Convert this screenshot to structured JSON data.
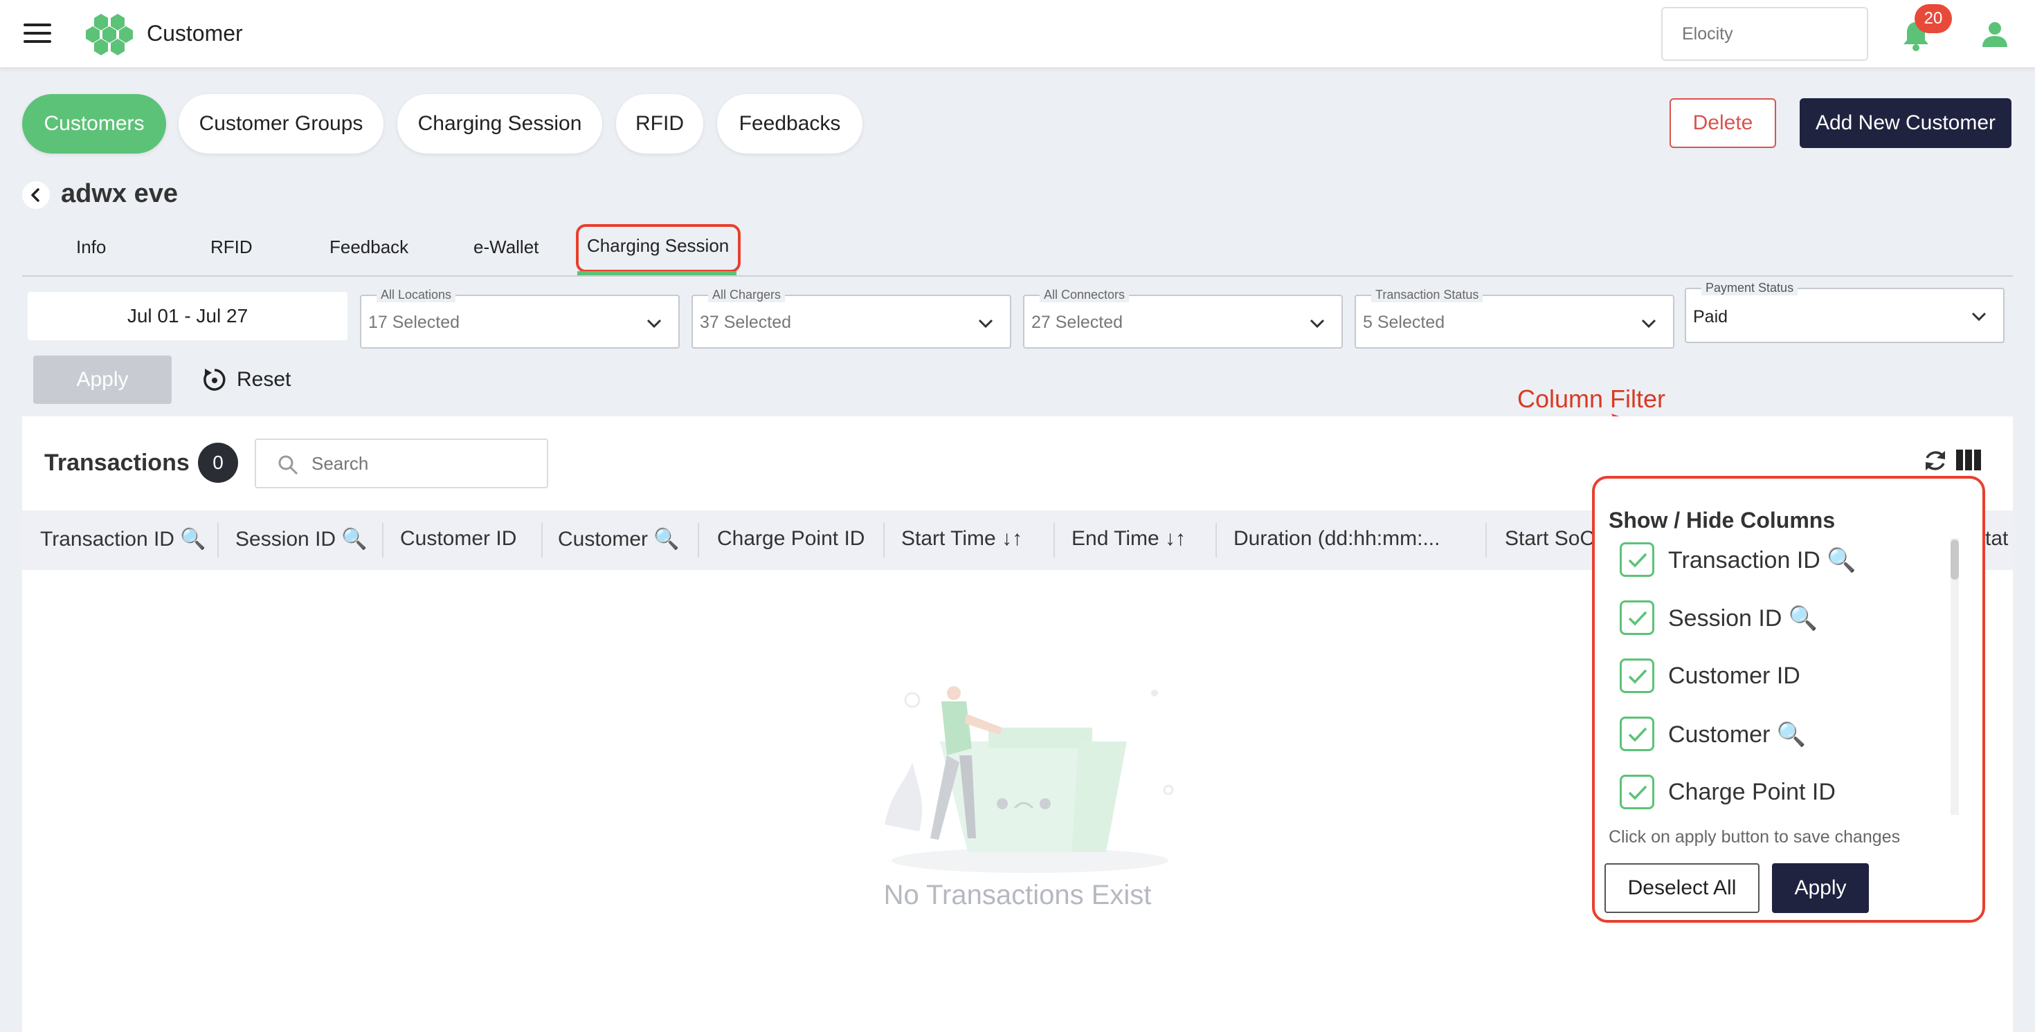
{
  "header": {
    "app_title": "Customer",
    "org_placeholder": "Elocity",
    "notification_count": "20"
  },
  "tabs": [
    {
      "label": "Customers",
      "active": true
    },
    {
      "label": "Customer Groups",
      "active": false
    },
    {
      "label": "Charging Session",
      "active": false
    },
    {
      "label": "RFID",
      "active": false
    },
    {
      "label": "Feedbacks",
      "active": false
    }
  ],
  "actions": {
    "delete": "Delete",
    "add_new": "Add New Customer"
  },
  "customer": {
    "name": "adwx eve"
  },
  "subtabs": [
    {
      "label": "Info"
    },
    {
      "label": "RFID"
    },
    {
      "label": "Feedback"
    },
    {
      "label": "e-Wallet"
    },
    {
      "label": "Charging Session",
      "active": true
    }
  ],
  "filters": {
    "date_range": "Jul 01 - Jul 27",
    "locations": {
      "label": "All Locations",
      "value": "17 Selected"
    },
    "chargers": {
      "label": "All Chargers",
      "value": "37 Selected"
    },
    "connectors": {
      "label": "All Connectors",
      "value": "27 Selected"
    },
    "transaction_status": {
      "label": "Transaction Status",
      "value": "5 Selected"
    },
    "payment_status": {
      "label": "Payment Status",
      "value": "Paid"
    },
    "apply": "Apply",
    "reset": "Reset"
  },
  "transactions": {
    "title": "Transactions",
    "count": "0",
    "search_placeholder": "Search",
    "columns": [
      "Transaction ID 🔍",
      "Session ID 🔍",
      "Customer ID",
      "Customer 🔍",
      "Charge Point ID",
      "Start Time ↓↑",
      "End Time ↓↑",
      "Duration (dd:hh:mm:...",
      "Start SoC",
      "Stat"
    ],
    "empty_text": "No Transactions Exist"
  },
  "annotation": {
    "label": "Column Filter",
    "color": "#d83a24"
  },
  "column_popup": {
    "title": "Show / Hide Columns",
    "items": [
      {
        "label": "Transaction ID 🔍",
        "checked": true
      },
      {
        "label": "Session ID 🔍",
        "checked": true
      },
      {
        "label": "Customer ID",
        "checked": true
      },
      {
        "label": "Customer 🔍",
        "checked": true
      },
      {
        "label": "Charge Point ID",
        "checked": true
      }
    ],
    "hint": "Click on apply button to save changes",
    "deselect_all": "Deselect All",
    "apply": "Apply"
  },
  "colors": {
    "accent_green": "#5cc277",
    "navy": "#1f2340",
    "danger": "#d9534f",
    "highlight_red": "#e8402e"
  }
}
